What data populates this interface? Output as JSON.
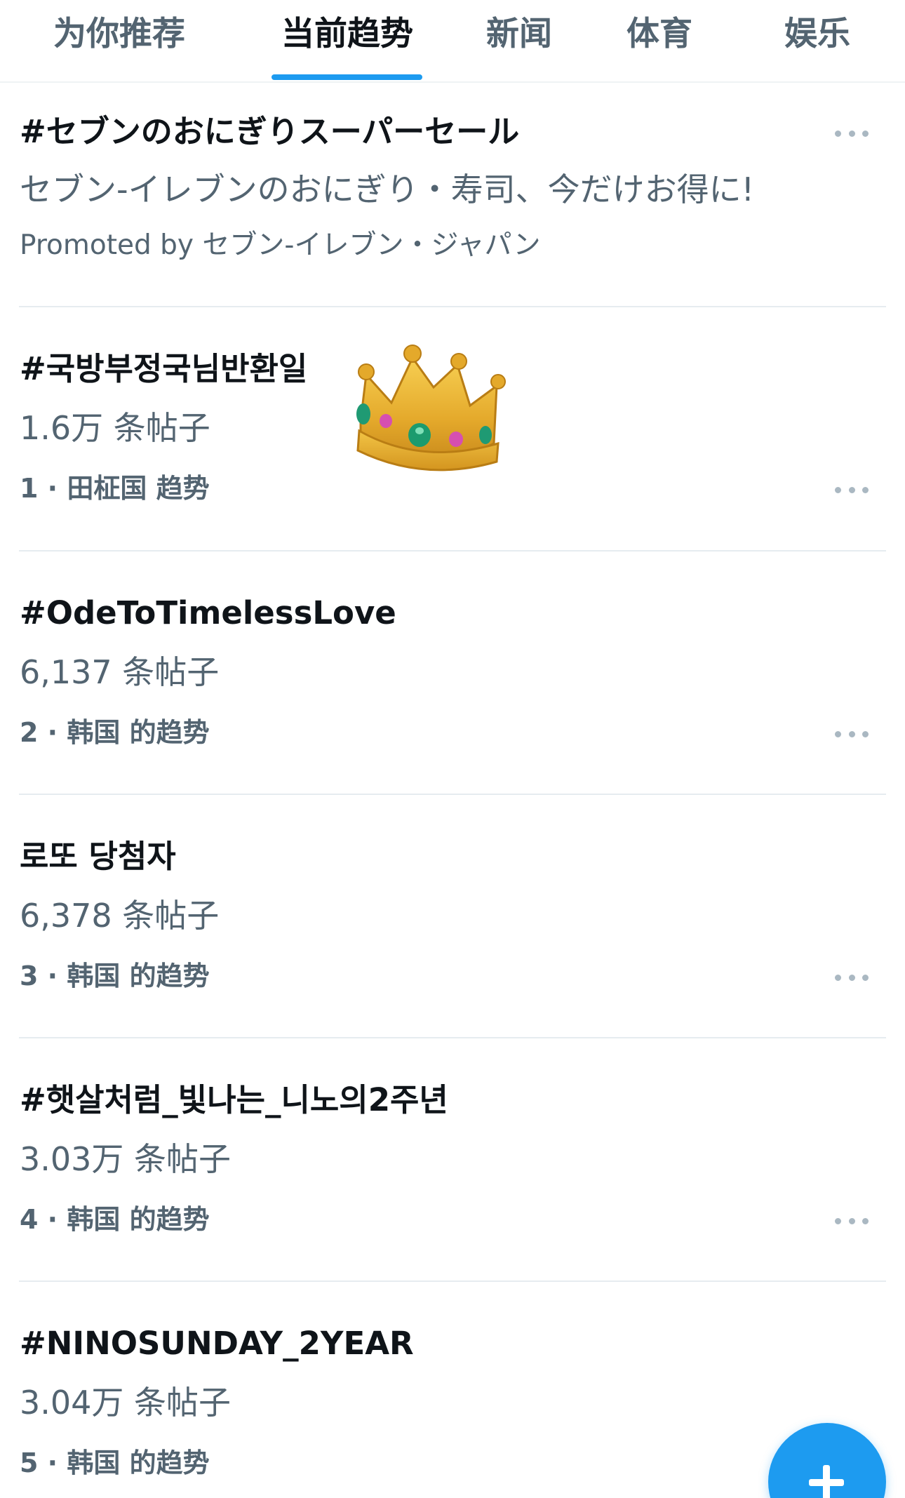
{
  "tabs": [
    {
      "label": "为你推荐",
      "active": false
    },
    {
      "label": "当前趋势",
      "active": true
    },
    {
      "label": "新闻",
      "active": false
    },
    {
      "label": "体育",
      "active": false
    },
    {
      "label": "娱乐",
      "active": false
    }
  ],
  "promoted": {
    "title": "#セブンのおにぎりスーパーセール",
    "description": "セブン-イレブンのおにぎり・寿司、今だけお得に!",
    "promoted_by": "Promoted by セブン-イレブン・ジャパン"
  },
  "trends": [
    {
      "title": "#국방부정국님반환일",
      "count": "1.6万 条帖子",
      "context": "1 · 田柾国 趋势",
      "emoji": "crown-emoji"
    },
    {
      "title": "#OdeToTimelessLove",
      "count": "6,137 条帖子",
      "context": "2 · 韩国 的趋势"
    },
    {
      "title": "로또 당첨자",
      "count": "6,378 条帖子",
      "context": "3 · 韩国 的趋势"
    },
    {
      "title": "#햇살처럼_빛나는_니노의2주년",
      "count": "3.03万 条帖子",
      "context": "4 · 韩国 的趋势"
    },
    {
      "title": "#NINOSUNDAY_2YEAR",
      "count": "3.04万 条帖子",
      "context": "5 · 韩国 的趋势"
    }
  ],
  "icons": {
    "more": "more-dots-icon",
    "compose": "plus-icon"
  },
  "colors": {
    "accent": "#1d9bf0",
    "primary_text": "#0f1419",
    "secondary_text": "#536471",
    "divider": "#e6ecf0"
  }
}
